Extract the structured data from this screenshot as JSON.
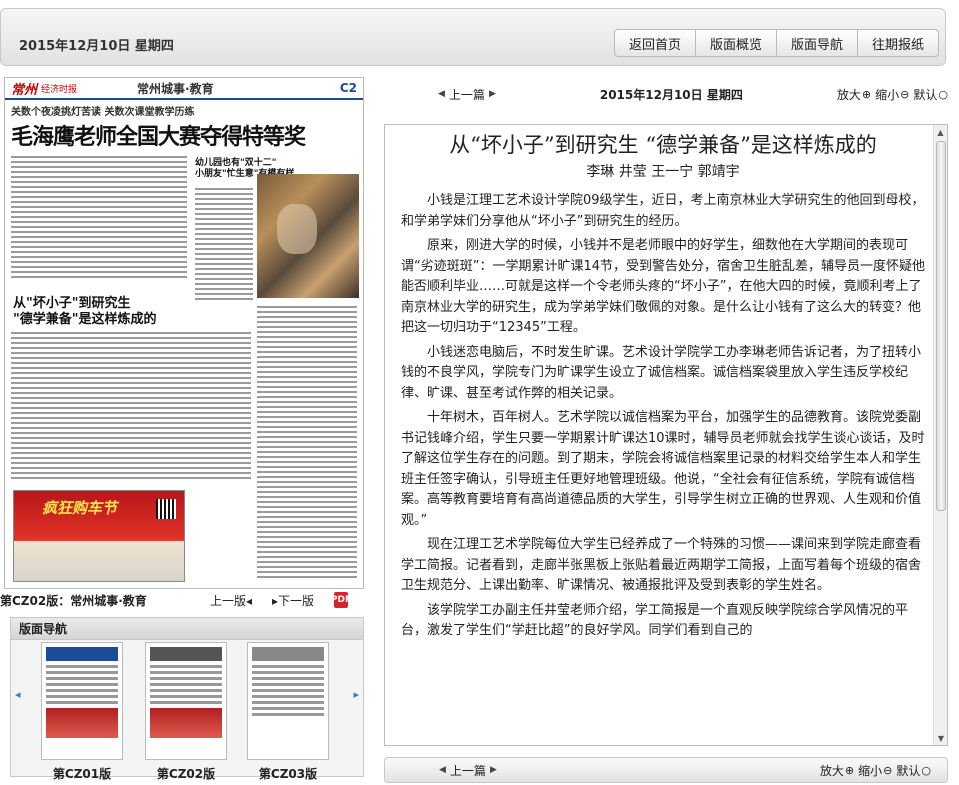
{
  "header": {
    "date": "2015年12月10日  星期四",
    "nav": [
      "返回首页",
      "版面概览",
      "版面导航",
      "往期报纸"
    ]
  },
  "newspaper": {
    "logo": "常州",
    "logo_sub": "经济时报",
    "section": "常州城事·教育",
    "page_no": "C2",
    "kicker": "关数个夜凌挑灯苦读 关数次课堂教学历练",
    "headline": "毛海鹰老师全国大赛夺得特等奖",
    "photo_title": "幼儿园也有\"双十二\"\n小朋友\"忙生意\"有模有样",
    "story2_title": "从\"坏小子\"到研究生\n\"德学兼备\"是这样炼成的",
    "ad_text": "疯狂购车节",
    "current_page": "第CZ02版：常州城事·教育",
    "prev_page": "上一版◂",
    "next_page": "▸下一版",
    "pdf_label": "PDF"
  },
  "section_nav": {
    "title": "版面导航",
    "pages": [
      "第CZ01版",
      "第CZ02版",
      "第CZ03版"
    ]
  },
  "article": {
    "prev": "上一篇",
    "date": "2015年12月10日  星期四",
    "zoom_in": "放大",
    "zoom_out": "缩小",
    "default": "默认",
    "title": "从“坏小子”到研究生 “德学兼备”是这样炼成的",
    "authors": "李琳  井莹  王一宁  郭靖宇",
    "paragraphs": [
      "小钱是江理工艺术设计学院09级学生，近日，考上南京林业大学研究生的他回到母校，和学弟学妹们分享他从“坏小子”到研究生的经历。",
      "原来，刚进大学的时候，小钱并不是老师眼中的好学生，细数他在大学期间的表现可谓“劣迹斑斑”：一学期累计旷课14节，受到警告处分，宿舍卫生脏乱差，辅导员一度怀疑他能否顺利毕业……可就是这样一个令老师头疼的“坏小子”，在他大四的时候，竟顺利考上了南京林业大学的研究生，成为学弟学妹们敬佩的对象。是什么让小钱有了这么大的转变？他把这一切归功于“12345”工程。",
      "小钱迷恋电脑后，不时发生旷课。艺术设计学院学工办李琳老师告诉记者，为了扭转小钱的不良学风，学院专门为旷课学生设立了诚信档案。诚信档案袋里放入学生违反学校纪律、旷课、甚至考试作弊的相关记录。",
      "十年树木，百年树人。艺术学院以诚信档案为平台，加强学生的品德教育。该院党委副书记钱峰介绍，学生只要一学期累计旷课达10课时，辅导员老师就会找学生谈心谈话，及时了解这位学生存在的问题。到了期末，学院会将诚信档案里记录的材料交给学生本人和学生班主任签字确认，引导班主任更好地管理班级。他说，“全社会有征信系统，学院有诚信档案。高等教育要培育有高尚道德品质的大学生，引导学生树立正确的世界观、人生观和价值观。”",
      "现在江理工艺术学院每位大学生已经养成了一个特殊的习惯——课间来到学院走廊查看学工简报。记者看到，走廊半张黑板上张贴着最近两期学工简报，上面写着每个班级的宿舍卫生规范分、上课出勤率、旷课情况、被通报批评及受到表彰的学生姓名。",
      "该学院学工办副主任井莹老师介绍，学工简报是一个直观反映学院综合学风情况的平台，激发了学生们“学赶比超”的良好学风。同学们看到自己的"
    ]
  }
}
